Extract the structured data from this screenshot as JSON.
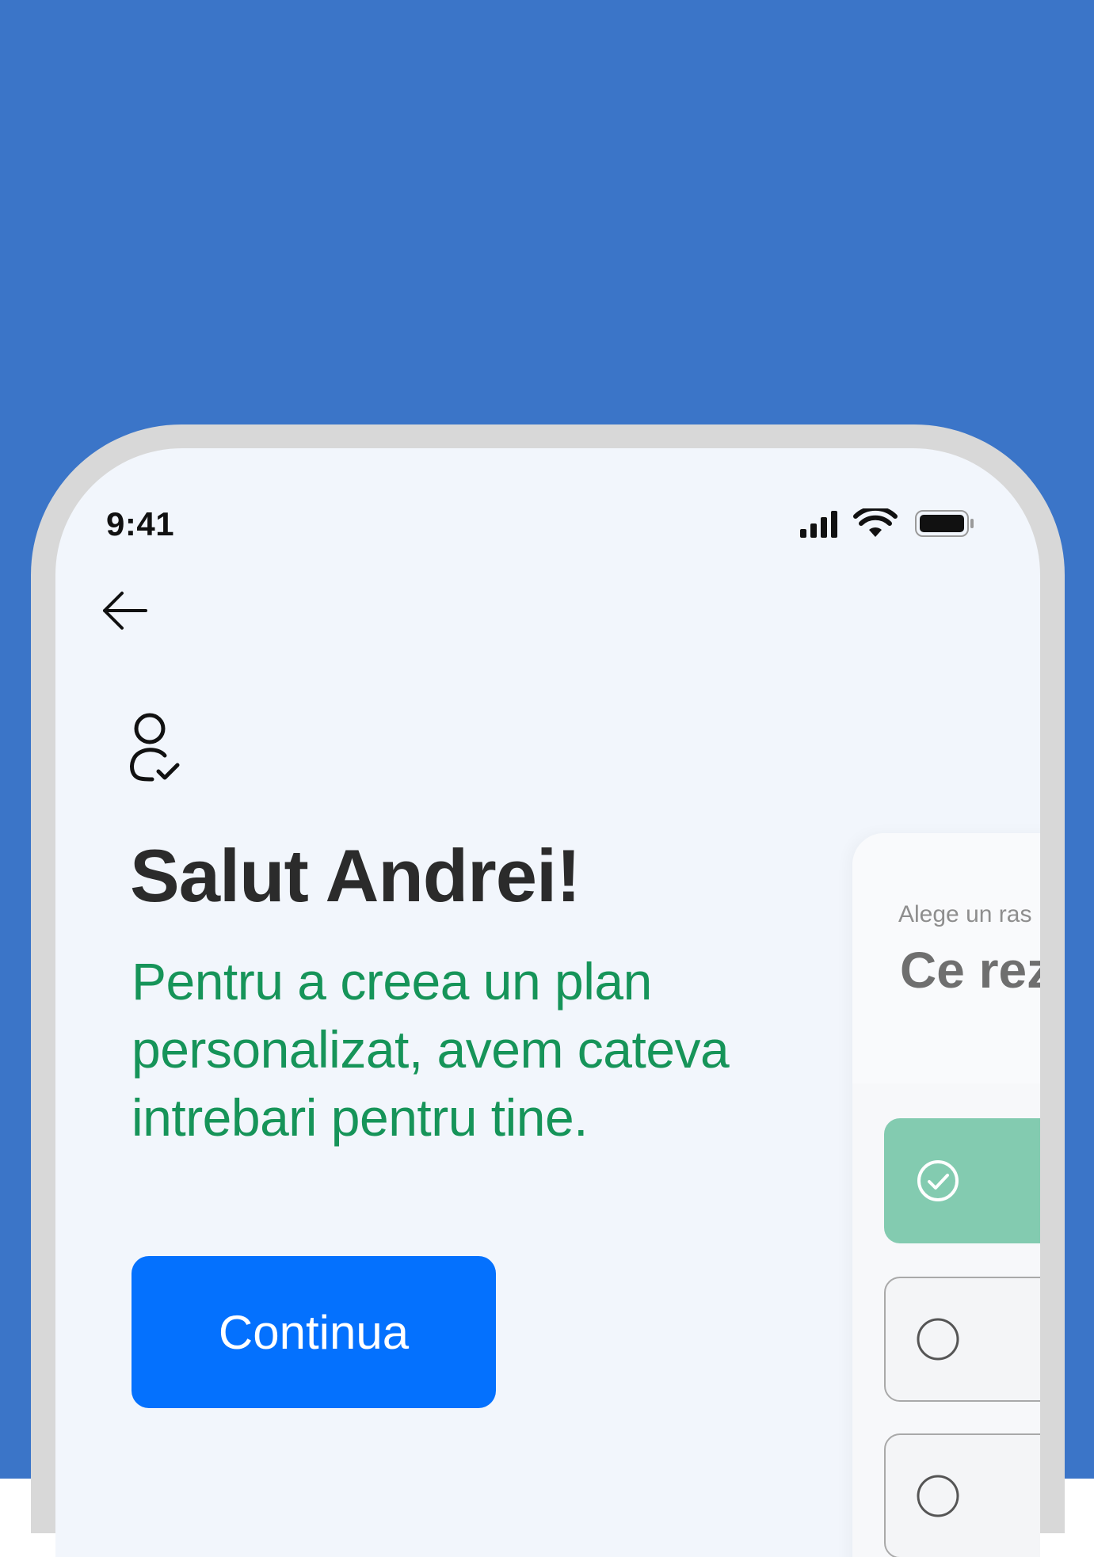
{
  "colors": {
    "background": "#3b75c8",
    "frame": "#d8d8d8",
    "screen": "#f2f6fc",
    "title": "#2b2b2b",
    "subtitle": "#169459",
    "primary_button": "#0471fe",
    "selected_option": "#83cbb0"
  },
  "status_bar": {
    "time": "9:41",
    "icons": [
      "cellular-signal-icon",
      "wifi-icon",
      "battery-icon"
    ]
  },
  "nav": {
    "back_icon": "arrow-left-icon"
  },
  "main": {
    "icon": "user-check-icon",
    "title": "Salut Andrei!",
    "subtitle": "Pentru a creea un plan personalizat, avem cateva intrebari pentru tine.",
    "continue_label": "Continua"
  },
  "next_card": {
    "label": "Alege un ras",
    "question": "Ce rez",
    "options": [
      {
        "state": "selected",
        "icon": "check-circle-icon"
      },
      {
        "state": "unselected",
        "icon": "radio-empty-icon"
      },
      {
        "state": "unselected",
        "icon": "radio-empty-icon"
      }
    ]
  }
}
